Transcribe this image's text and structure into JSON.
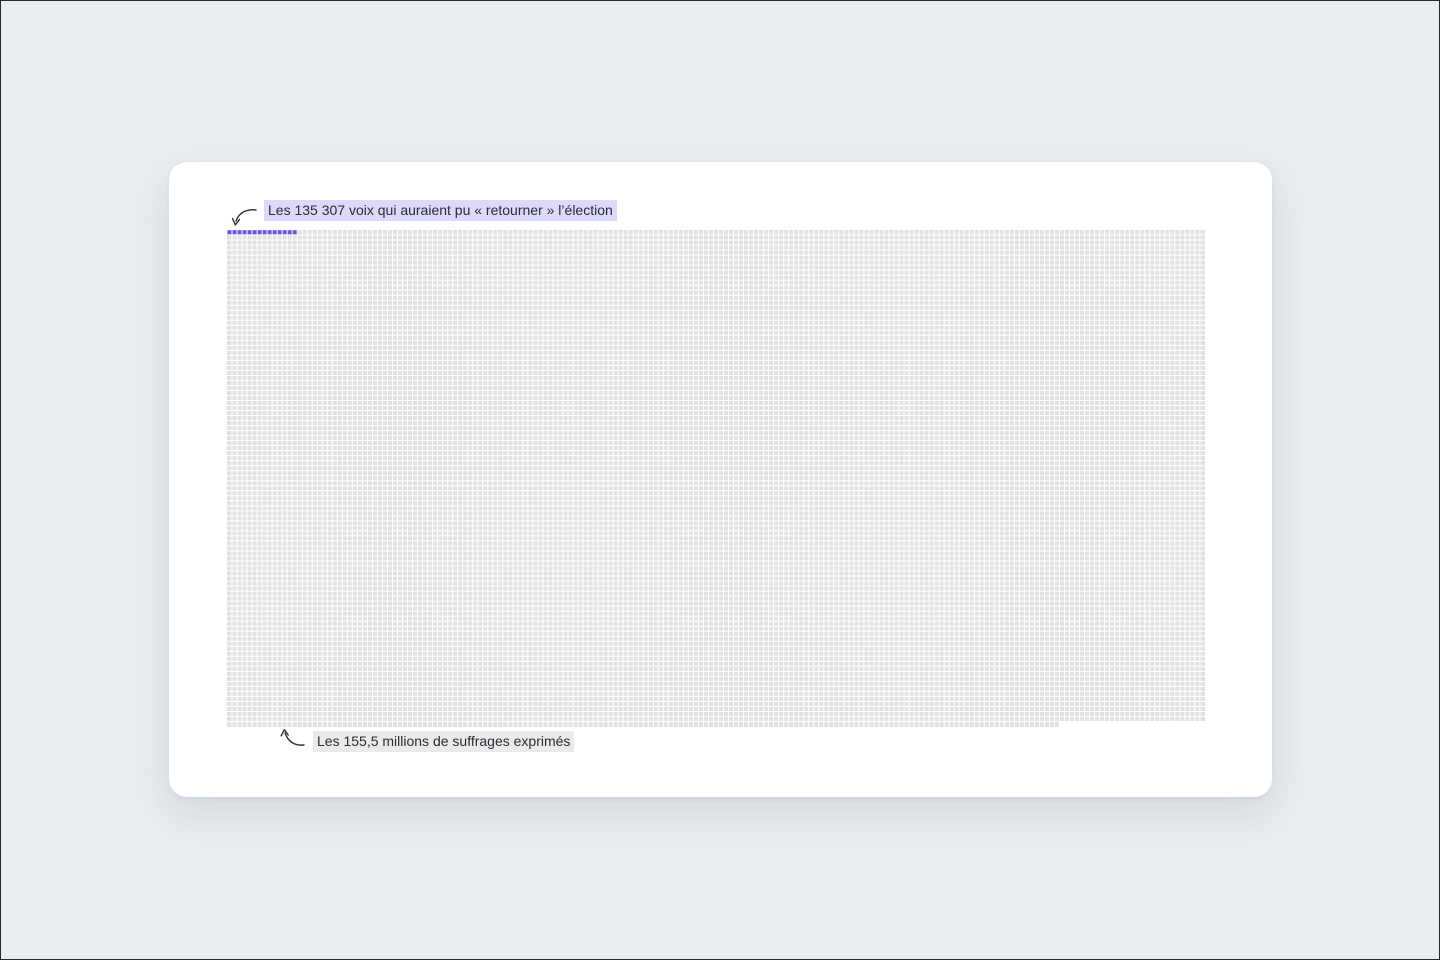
{
  "chart_data": {
    "type": "waffle",
    "cell_colors": {
      "highlight": "#6a56e0",
      "base": "#e2e2e2",
      "label_highlight_bg": "#dcd9fb",
      "label_base_bg": "#eaeaea"
    },
    "grid_columns": 195,
    "grid_rows": 99,
    "highlight_cells": 14,
    "annotations": {
      "highlight_label": "Les 135 307 voix qui auraient pu « retourner » l’élection",
      "total_label": "Les 155,5 millions de suffrages exprimés"
    }
  }
}
